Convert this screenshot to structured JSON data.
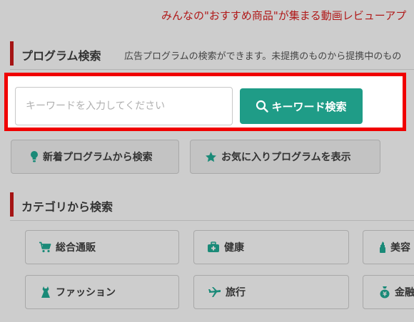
{
  "banner": {
    "text": "みんなの\"おすすめ商品\"が集まる動画レビューアプ"
  },
  "program_search": {
    "title": "プログラム検索",
    "description": "広告プログラムの検索ができます。未提携のものから提携中のもの",
    "input_placeholder": "キーワードを入力してください",
    "input_value": "",
    "search_button_label": "キーワード検索",
    "new_programs_label": "新着プログラムから検索",
    "favorites_label": "お気に入りプログラムを表示"
  },
  "category_search": {
    "title": "カテゴリから検索",
    "categories": [
      {
        "label": "総合通販",
        "icon": "cart-icon"
      },
      {
        "label": "健康",
        "icon": "first-aid-kit-icon"
      },
      {
        "label": "美容",
        "icon": "lipstick-icon"
      },
      {
        "label": "ファッション",
        "icon": "dress-icon"
      },
      {
        "label": "旅行",
        "icon": "airplane-icon"
      },
      {
        "label": "金融",
        "icon": "money-bag-icon"
      }
    ]
  },
  "colors": {
    "accent_red": "#a51414",
    "highlight_border": "#f00000",
    "button_teal": "#1f9c87",
    "icon_teal": "#1a8a78",
    "banner_text": "#b01818"
  }
}
